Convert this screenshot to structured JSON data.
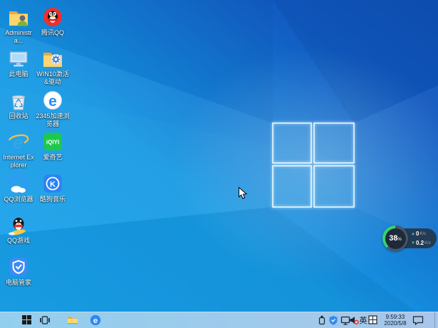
{
  "desktop": {
    "columns": [
      {
        "items": [
          {
            "label": "Administra...",
            "icon": "folder-user-icon"
          },
          {
            "label": "此电脑",
            "icon": "this-pc-icon"
          },
          {
            "label": "回收站",
            "icon": "recycle-bin-icon"
          },
          {
            "label": "Internet Explorer",
            "icon": "internet-explorer-icon"
          },
          {
            "label": "QQ浏览器",
            "icon": "qq-browser-icon"
          },
          {
            "label": "QQ游戏",
            "icon": "qq-game-icon"
          },
          {
            "label": "电脑管家",
            "icon": "pc-manager-icon"
          }
        ]
      },
      {
        "items": [
          {
            "label": "腾讯QQ",
            "icon": "tencent-qq-icon"
          },
          {
            "label": "WIN10激活&驱动",
            "icon": "folder-gear-icon"
          },
          {
            "label": "2345加速浏览器",
            "icon": "browser-2345-icon"
          },
          {
            "label": "爱奇艺",
            "icon": "iqiyi-icon"
          },
          {
            "label": "酷狗音乐",
            "icon": "kugou-music-icon"
          }
        ]
      }
    ]
  },
  "icon_text": {
    "iqiyi": "iQIYI",
    "kugou": "K",
    "browser_e": "e",
    "ie_e": "e"
  },
  "speed_ball": {
    "memory_percent": "38",
    "percent_sign": "%",
    "up_arrow": "▲",
    "down_arrow": "▼",
    "upload": {
      "value": "0",
      "unit": "K/s"
    },
    "download": {
      "value": "0.2",
      "unit": "K/s"
    }
  },
  "taskbar": {
    "buttons": [
      {
        "icon": "start"
      },
      {
        "icon": "task-view"
      },
      {
        "icon": "file-explorer"
      },
      {
        "icon": "browser-2345"
      }
    ],
    "tray": [
      {
        "icon": "usb-device"
      },
      {
        "icon": "security-shield"
      },
      {
        "icon": "display"
      },
      {
        "icon": "volume-muted"
      },
      {
        "icon": "ime-keyboard"
      },
      {
        "icon": "action-center"
      }
    ],
    "ime_language": "英",
    "clock": {
      "time": "9:59:33",
      "date": "2020/5/8"
    }
  },
  "colors": {
    "wallpaper_left": "#18a2ea",
    "wallpaper_right": "#1254bd",
    "taskbar": "#9ecbe9",
    "ball_arc_green": "#38d16d",
    "upload_arrow_blue": "#4db2ff",
    "download_arrow_green": "#43cf6c"
  }
}
